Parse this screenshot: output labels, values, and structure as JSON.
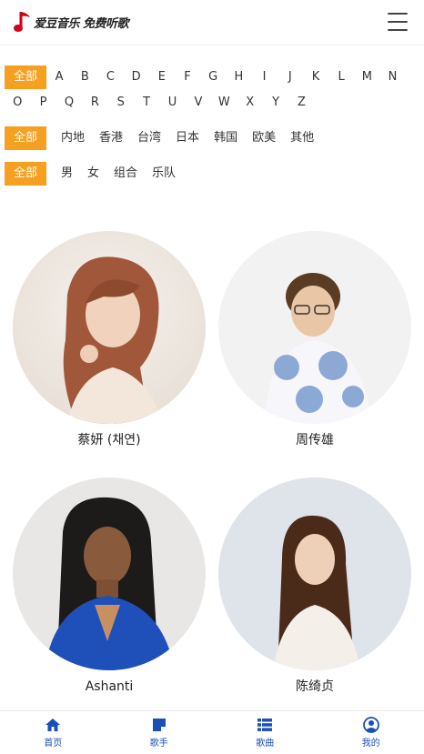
{
  "header": {
    "logo_text": "爱豆音乐 免费听歌",
    "brand_color": "#d0021b"
  },
  "filters": {
    "all_label": "全部",
    "accent_color": "#f5a020",
    "letters_row1": [
      "A",
      "B",
      "C",
      "D",
      "E",
      "F",
      "G",
      "H",
      "I",
      "J",
      "K",
      "L",
      "M",
      "N"
    ],
    "letters_row2": [
      "O",
      "P",
      "Q",
      "R",
      "S",
      "T",
      "U",
      "V",
      "W",
      "X",
      "Y",
      "Z"
    ],
    "regions": [
      "内地",
      "香港",
      "台湾",
      "日本",
      "韩国",
      "欧美",
      "其他"
    ],
    "genders": [
      "男",
      "女",
      "组合",
      "乐队"
    ]
  },
  "artists": [
    {
      "name": "蔡妍 (채연)"
    },
    {
      "name": "周传雄"
    },
    {
      "name": "Ashanti"
    },
    {
      "name": "陈绮贞"
    }
  ],
  "tabbar": {
    "items": [
      {
        "label": "首页",
        "icon": "home-icon"
      },
      {
        "label": "歌手",
        "icon": "singer-icon"
      },
      {
        "label": "歌曲",
        "icon": "list-icon"
      },
      {
        "label": "我的",
        "icon": "user-icon"
      }
    ],
    "color": "#1a4fb5"
  }
}
